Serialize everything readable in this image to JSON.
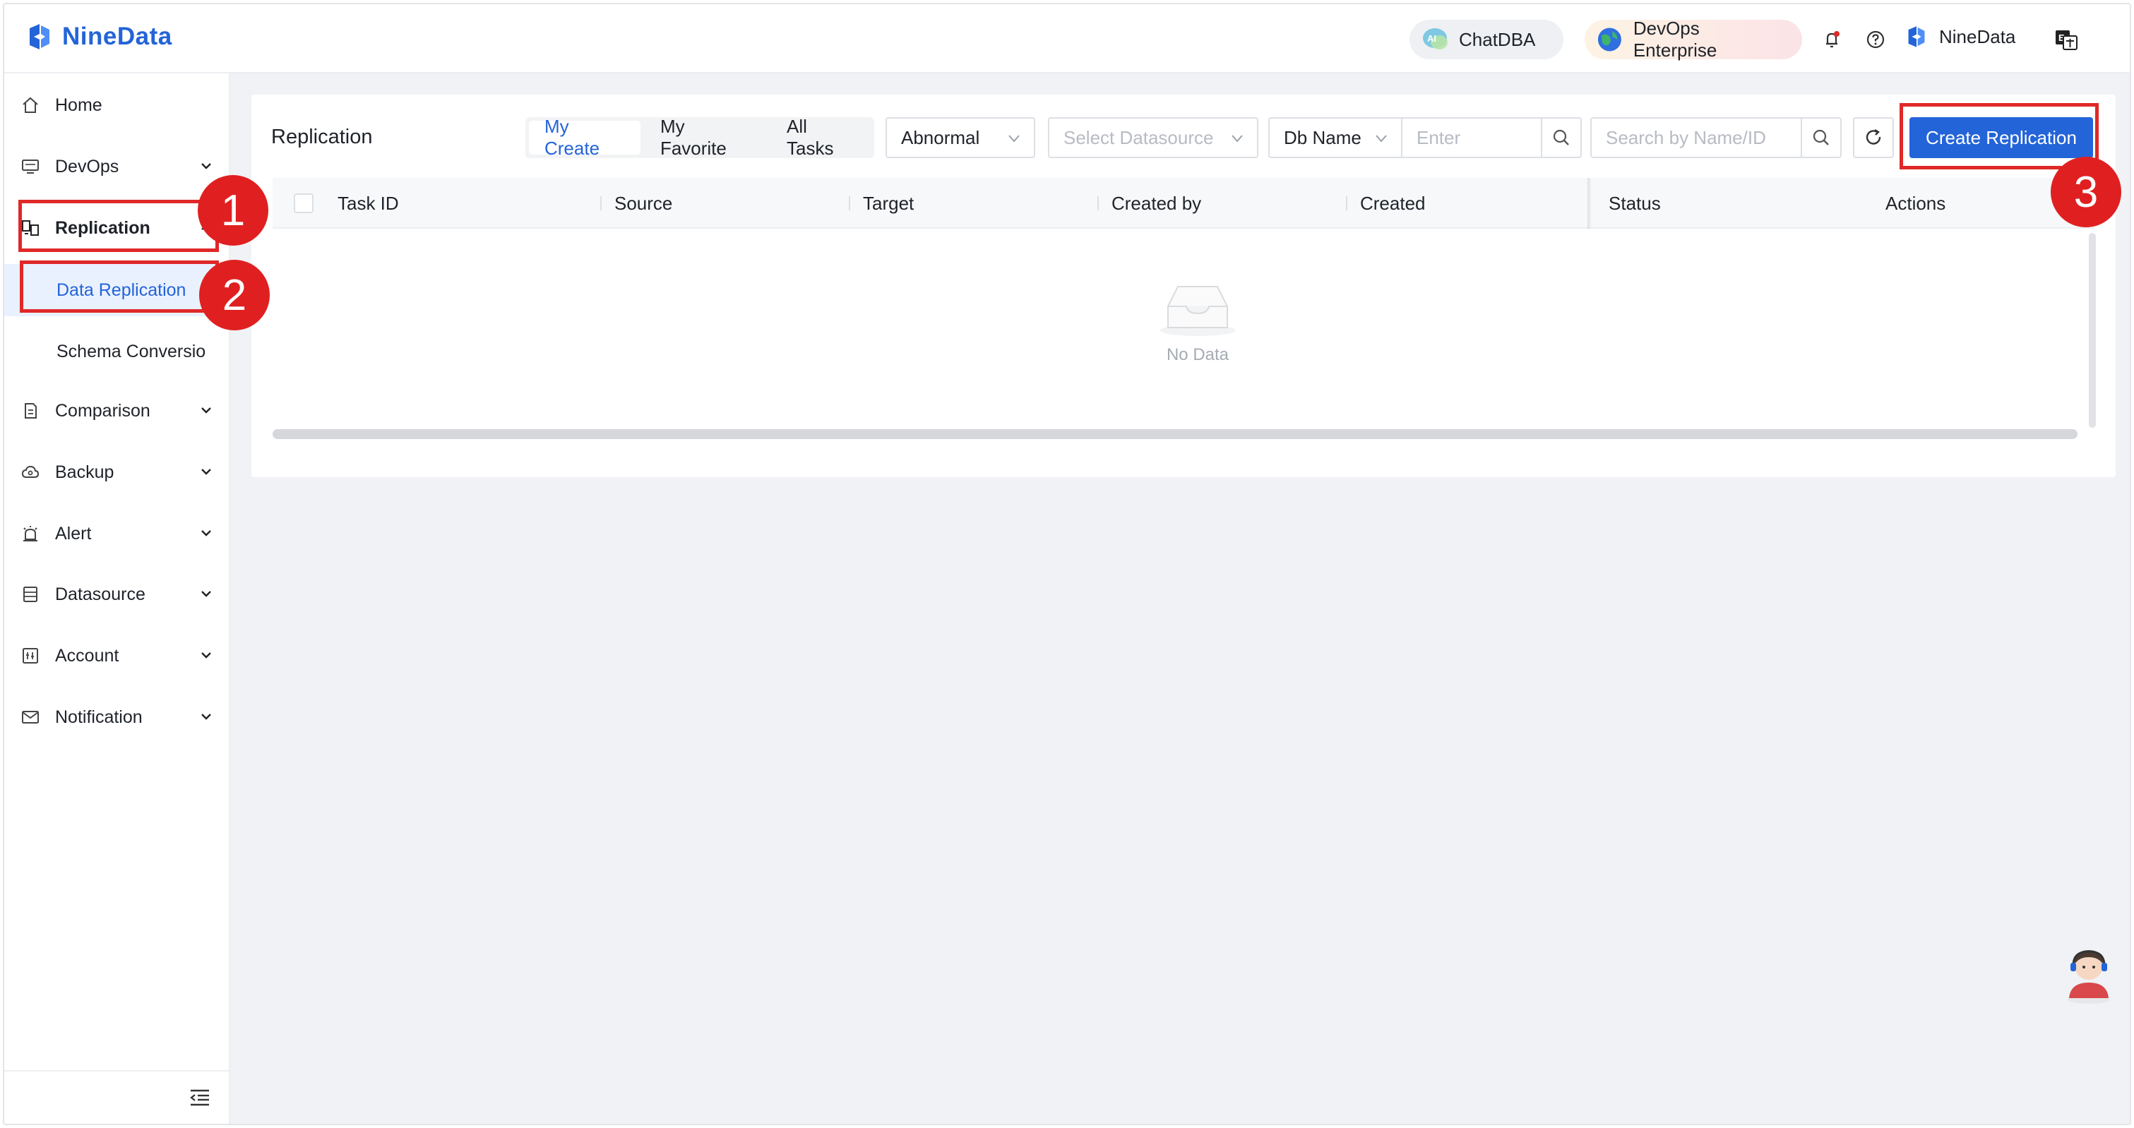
{
  "header": {
    "logo_text": "NineData",
    "chatdba_label": "ChatDBA",
    "devops_label": "DevOps Enterprise",
    "user_name": "NineData"
  },
  "sidebar": {
    "items": [
      {
        "label": "Home",
        "icon": "home-icon"
      },
      {
        "label": "DevOps",
        "icon": "monitor-icon"
      },
      {
        "label": "Replication",
        "icon": "replication-icon"
      },
      {
        "label": "Data Replication"
      },
      {
        "label": "Schema Conversio"
      },
      {
        "label": "Comparison",
        "icon": "document-icon"
      },
      {
        "label": "Backup",
        "icon": "cloud-icon"
      },
      {
        "label": "Alert",
        "icon": "alarm-icon"
      },
      {
        "label": "Datasource",
        "icon": "database-icon"
      },
      {
        "label": "Account",
        "icon": "account-icon"
      },
      {
        "label": "Notification",
        "icon": "mail-icon"
      }
    ]
  },
  "main": {
    "title": "Replication",
    "tabs": [
      "My Create",
      "My Favorite",
      "All Tasks"
    ],
    "selected_tab": "My Create",
    "status_filter": "Abnormal",
    "datasource_placeholder": "Select Datasource",
    "db_select": "Db Name",
    "db_input_placeholder": "Enter",
    "search_placeholder": "Search by Name/ID",
    "create_button": "Create Replication"
  },
  "table": {
    "columns": [
      "Task ID",
      "Source",
      "Target",
      "Created by",
      "Created",
      "Status",
      "Actions"
    ],
    "rows": [],
    "empty_text": "No Data"
  },
  "annotations": [
    "1",
    "2",
    "3"
  ],
  "colors": {
    "accent": "#2364d8",
    "annotation_red": "#e02828",
    "background": "#f0f2f5"
  }
}
